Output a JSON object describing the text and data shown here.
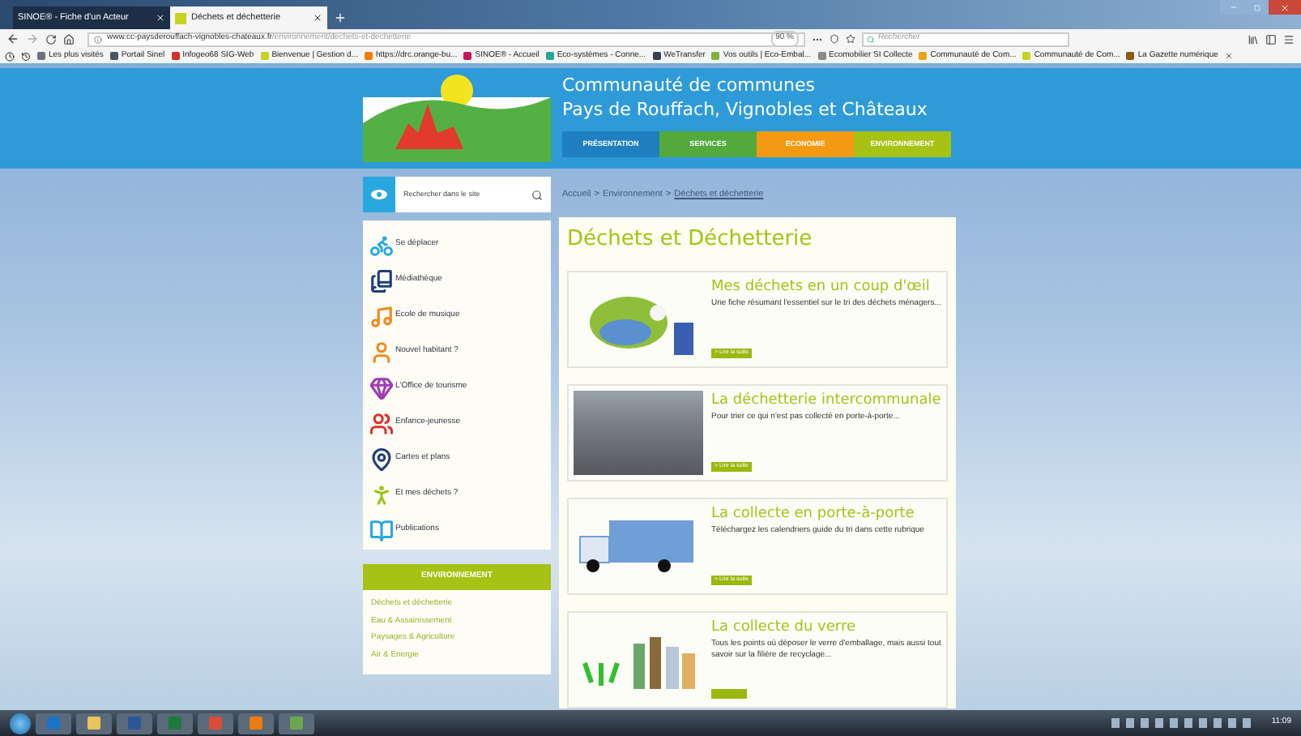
{
  "browser": {
    "tabs": [
      {
        "title": "SINOE® - Fiche d'un Acteur",
        "selected": false
      },
      {
        "title": "Déchets et déchetterie",
        "selected": true
      }
    ],
    "url_host": "www.cc-paysderouffach-vignobles-chateaux.fr",
    "url_path": "/environnement/dechets-et-dechetterie",
    "zoom": "90 %",
    "search_placeholder": "Rechercher",
    "bookmarks": [
      {
        "label": "Les plus visités",
        "color": "#6b7280"
      },
      {
        "label": "Portail Sinel",
        "color": "#4b5563"
      },
      {
        "label": "Infogeo68 SIG-Web",
        "color": "#d32f2f"
      },
      {
        "label": "Bienvenue | Gestion d...",
        "color": "#c6d41c"
      },
      {
        "label": "https://drc.orange-bu...",
        "color": "#f57c00"
      },
      {
        "label": "SINOE® - Accueil",
        "color": "#c2185b"
      },
      {
        "label": "Eco-systèmes - Conne...",
        "color": "#26a69a"
      },
      {
        "label": "WeTransfer",
        "color": "#374151"
      },
      {
        "label": "Vos outils | Eco-Embal...",
        "color": "#7cb342"
      },
      {
        "label": "Ecomobilier SI Collecte",
        "color": "#8a8a8a"
      },
      {
        "label": "Communauté de Com...",
        "color": "#e6a817"
      },
      {
        "label": "Communauté de Com...",
        "color": "#c6d41c"
      },
      {
        "label": "La Gazette numérique",
        "color": "#8d5a1a"
      }
    ]
  },
  "site": {
    "title_line1": "Communauté de communes",
    "title_line2": "Pays de Rouffach, Vignobles et Châteaux",
    "nav": [
      {
        "label": "PRÉSENTATION",
        "color": "#1f7fc0"
      },
      {
        "label": "SERVICES",
        "color": "#53a93b"
      },
      {
        "label": "ECONOMIE",
        "color": "#f39a12"
      },
      {
        "label": "ENVIRONNEMENT",
        "color": "#a6c214"
      }
    ],
    "search_placeholder": "Rechercher dans le site",
    "quick_links": [
      {
        "label": "Se déplacer",
        "color": "#29a8e0"
      },
      {
        "label": "Médiathèque",
        "color": "#1f3f78"
      },
      {
        "label": "Ecole de musique",
        "color": "#f08a1c"
      },
      {
        "label": "Nouvel habitant ?",
        "color": "#f08a1c"
      },
      {
        "label": "L'Office de tourisme",
        "color": "#a03bb5"
      },
      {
        "label": "Enfance-jeunesse",
        "color": "#e0312f"
      },
      {
        "label": "Cartes et plans",
        "color": "#1f3f78"
      },
      {
        "label": "Et mes déchets ?",
        "color": "#9cc21a"
      },
      {
        "label": "Publications",
        "color": "#29a8e0"
      }
    ],
    "section": {
      "heading": "ENVIRONNEMENT",
      "links": [
        "Déchets et déchetterie",
        "Eau & Assainissement",
        "Paysages & Agriculture",
        "Air & Energie"
      ]
    },
    "breadcrumb": [
      {
        "label": "Accueil",
        "kind": "text"
      },
      {
        "label": ">",
        "kind": "text"
      },
      {
        "label": "Environnement",
        "kind": "text"
      },
      {
        "label": ">",
        "kind": "text"
      },
      {
        "label": "Déchets et déchetterie",
        "kind": "link"
      }
    ],
    "heading": "Déchets et Déchetterie",
    "cards": [
      {
        "title": "Mes déchets en un coup d'œil",
        "text": "Une fiche résumant l'essentiel sur le tri des déchets ménagers...",
        "button": "> Lire la suite",
        "kind": "cartoon"
      },
      {
        "title": "La déchetterie intercommunale",
        "text": "Pour trier ce qui n'est pas collecté en porte-à-porte...",
        "button": "> Lire la suite",
        "kind": "photo"
      },
      {
        "title": "La collecte en porte-à-porte",
        "text": "Téléchargez les calendriers guide du tri dans cette rubrique",
        "button": "> Lire la suite",
        "kind": "truck"
      },
      {
        "title": "La collecte du verre",
        "text": "Tous les points où déposer le verre d'emballage, mais aussi tout savoir sur la filière de recyclage...",
        "kind": "bottles"
      }
    ]
  },
  "taskbar": {
    "time": "11:09"
  }
}
